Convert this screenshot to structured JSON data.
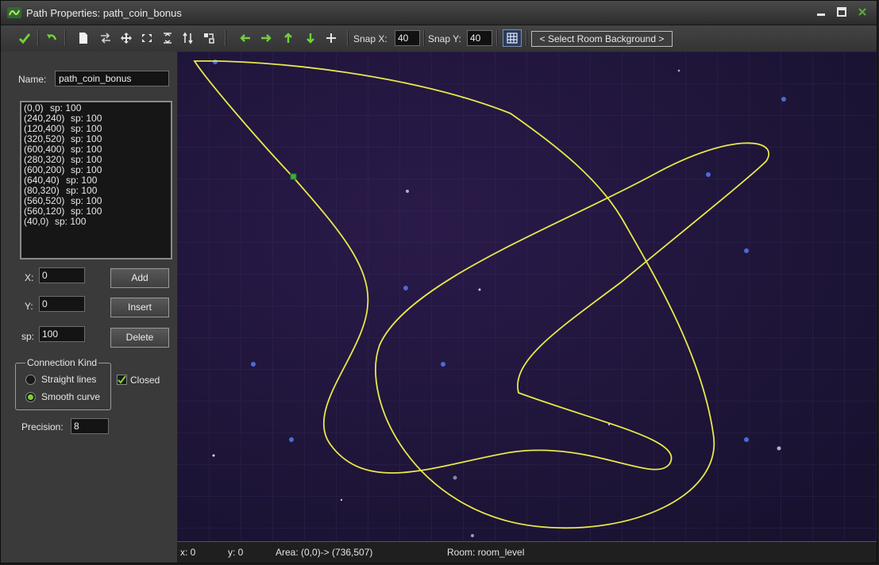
{
  "window": {
    "title": "Path Properties: path_coin_bonus"
  },
  "toolbar": {
    "snap_x_label": "Snap X:",
    "snap_x_value": "40",
    "snap_y_label": "Snap Y:",
    "snap_y_value": "40",
    "room_background_label": "< Select Room Background >"
  },
  "sidebar": {
    "name_label": "Name:",
    "name_value": "path_coin_bonus",
    "points": [
      {
        "coord": "(0,0)",
        "speed": "sp: 100"
      },
      {
        "coord": "(240,240)",
        "speed": "sp: 100"
      },
      {
        "coord": "(120,400)",
        "speed": "sp: 100"
      },
      {
        "coord": "(320,520)",
        "speed": "sp: 100"
      },
      {
        "coord": "(600,400)",
        "speed": "sp: 100"
      },
      {
        "coord": "(280,320)",
        "speed": "sp: 100"
      },
      {
        "coord": "(600,200)",
        "speed": "sp: 100"
      },
      {
        "coord": "(640,40)",
        "speed": "sp: 100"
      },
      {
        "coord": "(80,320)",
        "speed": "sp: 100"
      },
      {
        "coord": "(560,520)",
        "speed": "sp: 100"
      },
      {
        "coord": "(560,120)",
        "speed": "sp: 100"
      },
      {
        "coord": "(40,0)",
        "speed": "sp: 100"
      }
    ],
    "x_label": "X:",
    "x_value": "0",
    "y_label": "Y:",
    "y_value": "0",
    "sp_label": "sp:",
    "sp_value": "100",
    "add_label": "Add",
    "insert_label": "Insert",
    "delete_label": "Delete",
    "connection_kind_label": "Connection Kind",
    "straight_lines_label": "Straight lines",
    "smooth_curve_label": "Smooth curve",
    "connection_selected": "smooth",
    "closed_label": "Closed",
    "closed_checked": true,
    "precision_label": "Precision:",
    "precision_value": "8"
  },
  "status": {
    "x": "x: 0",
    "y": "y: 0",
    "area": "Area: (0,0)-> (736,507)",
    "room": "Room: room_level"
  },
  "colors": {
    "path_line": "#e8e84a",
    "point_marker": "#3cb043",
    "canvas_bg": "#1b1436",
    "check_accent": "#7fcf3a"
  }
}
